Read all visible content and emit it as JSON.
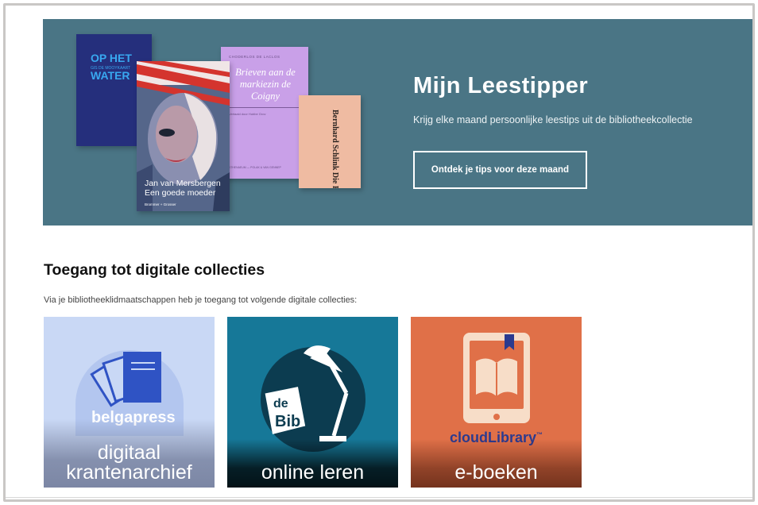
{
  "hero": {
    "title": "Mijn Leestipper",
    "subtitle": "Krijg elke maand persoonlijke leestips uit de bibliotheekcollectie",
    "button_label": "Ontdek je tips voor deze maand",
    "books": {
      "navy": {
        "title_line1": "OP HET",
        "title_line2": "WATER",
        "small_text": "GIS DE MOOYKAART"
      },
      "main": {
        "author": "Jan van Mersbergen",
        "title": "Een goede moeder",
        "publisher": "Brommer + Grosser"
      },
      "lilac": {
        "top_text": "CHODERLOS DE LACLOS",
        "title": "Brieven aan de markiezin de Coigny",
        "small_text": "Vertaald door Hubbe Grov",
        "bottom_text": "ATHENAEUM — POLAK & VAN GENNEP"
      },
      "peach": {
        "title": "Bernhard Schlink Die Frau"
      }
    }
  },
  "section": {
    "title": "Toegang tot digitale collecties",
    "subtitle": "Via je bibliotheeklidmaatschappen heb je toegang tot volgende digitale collecties:"
  },
  "tiles": [
    {
      "brand": "belgapress",
      "label_line1": "digitaal",
      "label_line2": "krantenarchief",
      "icon": "documents-icon",
      "color": "#c9d8f5"
    },
    {
      "brand": "de Bib",
      "label_line1": "online leren",
      "icon": "desk-lamp-icon",
      "color": "#167898"
    },
    {
      "brand": "cloudLibrary",
      "brand_tm": "™",
      "label_line1": "e-boeken",
      "icon": "tablet-book-icon",
      "color": "#e07048"
    }
  ],
  "colors": {
    "hero_bg": "#4a7585",
    "belga_blue": "#2f53c4",
    "cloud_blue": "#2b3a8f"
  }
}
